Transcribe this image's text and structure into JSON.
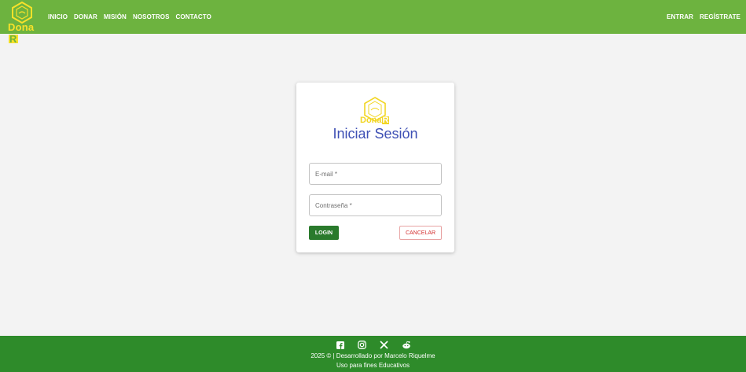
{
  "header": {
    "logo_text": "Dona",
    "logo_box": "R",
    "nav_left": [
      {
        "label": "INICIO"
      },
      {
        "label": "DONAR"
      },
      {
        "label": "MISIÓN"
      },
      {
        "label": "NOSOTROS"
      },
      {
        "label": "CONTACTO"
      }
    ],
    "nav_right": [
      {
        "label": "ENTRAR"
      },
      {
        "label": "REGÍSTRATE"
      }
    ]
  },
  "login": {
    "logo_text": "Dona",
    "logo_box": "R",
    "title": "Iniciar Sesión",
    "email_label": "E-mail *",
    "password_label": "Contraseña *",
    "login_button": "LOGIN",
    "cancel_button": "CANCELAR"
  },
  "footer": {
    "socials": [
      "facebook-icon",
      "instagram-icon",
      "x-icon",
      "reddit-icon"
    ],
    "line1": "2025 © | Desarrollado por Marcelo Riquelme",
    "line2": "Uso para fines Educativos"
  },
  "colors": {
    "header_bg": "#6db33f",
    "footer_bg": "#2e8b2a",
    "title": "#3f51b5",
    "login_btn": "#2a7a2c",
    "cancel_btn": "#d32f2f",
    "logo_yellow": "#f7e12a"
  }
}
